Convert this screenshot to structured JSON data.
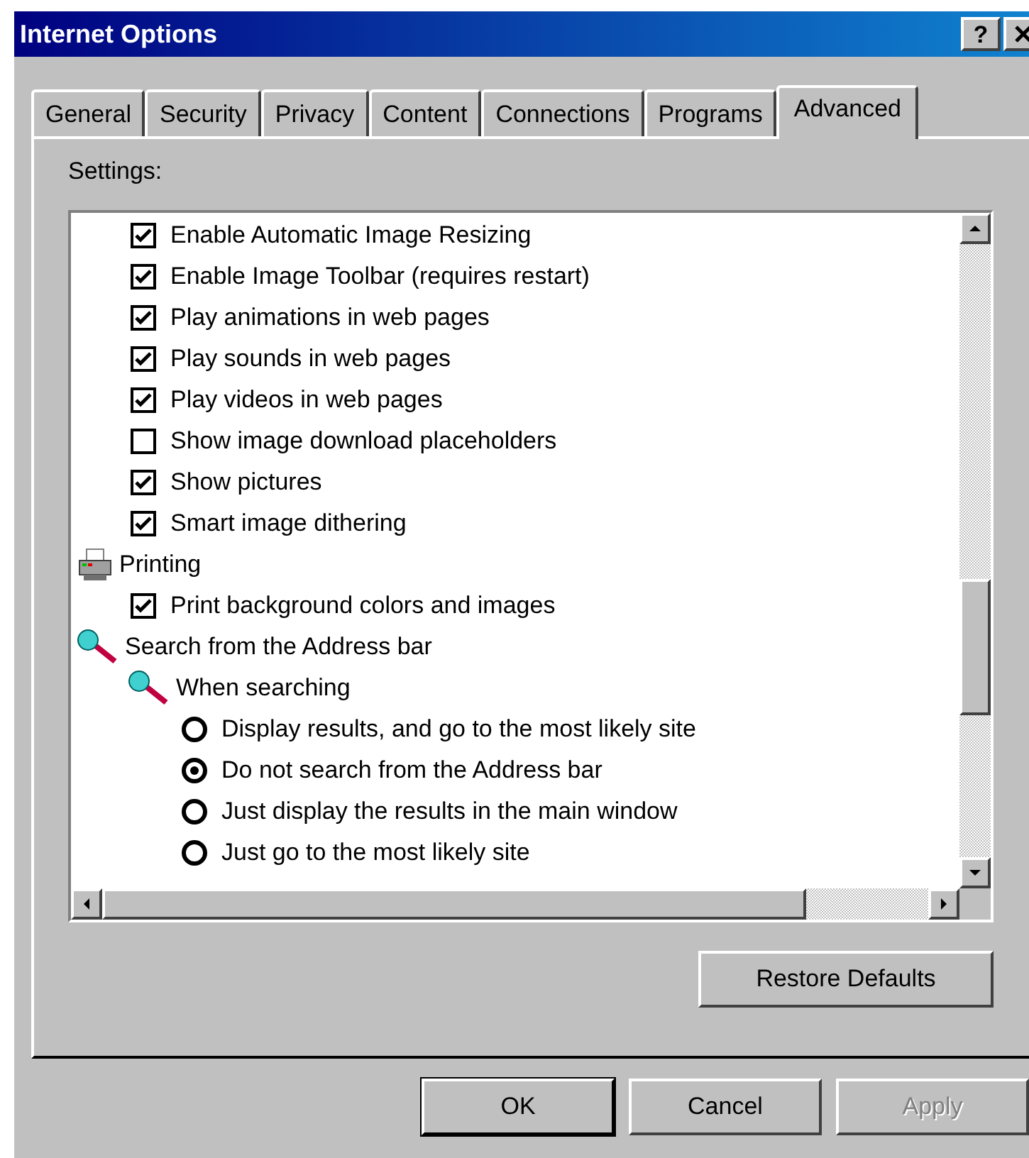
{
  "window": {
    "title": "Internet Options",
    "title_buttons": [
      "?"
    ]
  },
  "tabs": [
    {
      "label": "General",
      "selected": false
    },
    {
      "label": "Security",
      "selected": false
    },
    {
      "label": "Privacy",
      "selected": false
    },
    {
      "label": "Content",
      "selected": false
    },
    {
      "label": "Connections",
      "selected": false
    },
    {
      "label": "Programs",
      "selected": false
    },
    {
      "label": "Advanced",
      "selected": true
    }
  ],
  "settings_label": "Settings:",
  "settings": [
    {
      "kind": "group",
      "children": [
        {
          "kind": "checkbox",
          "label": "Enable Automatic Image Resizing",
          "checked": true
        },
        {
          "kind": "checkbox",
          "label": "Enable Image Toolbar (requires restart)",
          "checked": true
        },
        {
          "kind": "checkbox",
          "label": "Play animations in web pages",
          "checked": true
        },
        {
          "kind": "checkbox",
          "label": "Play sounds in web pages",
          "checked": true
        },
        {
          "kind": "checkbox",
          "label": "Play videos in web pages",
          "checked": true
        },
        {
          "kind": "checkbox",
          "label": "Show image download placeholders",
          "checked": false
        },
        {
          "kind": "checkbox",
          "label": "Show pictures",
          "checked": true
        },
        {
          "kind": "checkbox",
          "label": "Smart image dithering",
          "checked": true
        }
      ]
    },
    {
      "kind": "print_group",
      "label": "Printing",
      "children": [
        {
          "kind": "checkbox",
          "label": "Print background colors and images",
          "checked": true
        }
      ]
    },
    {
      "kind": "search_group",
      "label": "Search from the Address bar",
      "children": [
        {
          "kind": "search_group",
          "label": "When searching",
          "children": [
            {
              "kind": "radio",
              "label": "Display results, and go to the most likely site",
              "selected": false
            },
            {
              "kind": "radio",
              "label": "Do not search from the Address bar",
              "selected": true
            },
            {
              "kind": "radio",
              "label": "Just display the results in the main window",
              "selected": false
            },
            {
              "kind": "radio",
              "label": "Just go to the most likely site",
              "selected": false
            }
          ]
        }
      ]
    }
  ],
  "restore_button": "Restore Defaults",
  "buttons": [
    {
      "label": "OK",
      "disabled": false
    },
    {
      "label": "Cancel",
      "disabled": false
    },
    {
      "label": "Apply",
      "disabled": true
    }
  ]
}
